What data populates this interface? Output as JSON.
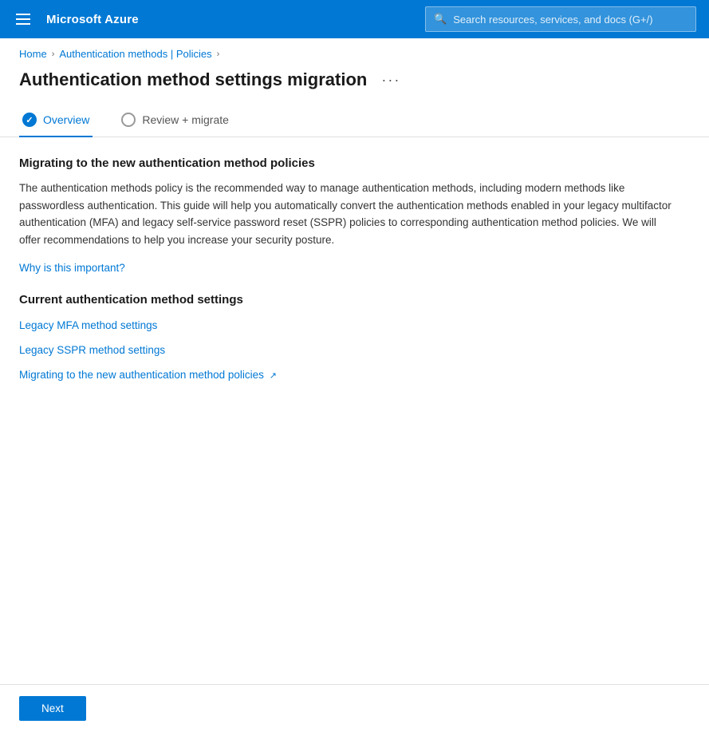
{
  "nav": {
    "logo": "Microsoft Azure",
    "search_placeholder": "Search resources, services, and docs (G+/)"
  },
  "breadcrumb": {
    "home": "Home",
    "parent": "Authentication methods | Policies"
  },
  "header": {
    "title": "Authentication method settings migration",
    "more_options_label": "···"
  },
  "tabs": [
    {
      "id": "overview",
      "label": "Overview",
      "active": true,
      "indicator": "filled"
    },
    {
      "id": "review-migrate",
      "label": "Review + migrate",
      "active": false,
      "indicator": "empty"
    }
  ],
  "content": {
    "section1_title": "Migrating to the new authentication method policies",
    "section1_description": "The authentication methods policy is the recommended way to manage authentication methods, including modern methods like passwordless authentication. This guide will help you automatically convert the authentication methods enabled in your legacy multifactor authentication (MFA) and legacy self-service password reset (SSPR) policies to corresponding authentication method policies. We will offer recommendations to help you increase your security posture.",
    "important_link": "Why is this important?",
    "section2_title": "Current authentication method settings",
    "links": [
      {
        "label": "Legacy MFA method settings",
        "external": false
      },
      {
        "label": "Legacy SSPR method settings",
        "external": false
      },
      {
        "label": "Migrating to the new authentication method policies",
        "external": true
      }
    ]
  },
  "footer": {
    "next_label": "Next"
  }
}
